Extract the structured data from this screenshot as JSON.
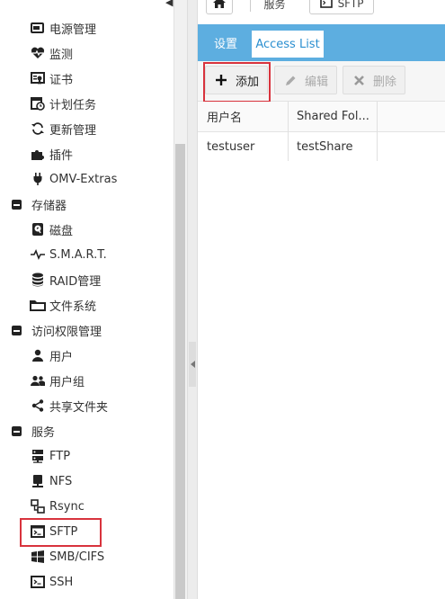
{
  "sidebar": {
    "items": [
      {
        "label": "电源管理",
        "icon": "power-icon"
      },
      {
        "label": "监测",
        "icon": "heart-pulse-icon"
      },
      {
        "label": "证书",
        "icon": "certificate-icon"
      },
      {
        "label": "计划任务",
        "icon": "calendar-clock-icon"
      },
      {
        "label": "更新管理",
        "icon": "refresh-icon"
      },
      {
        "label": "插件",
        "icon": "puzzle-icon"
      },
      {
        "label": "OMV-Extras",
        "icon": "plug-icon"
      },
      {
        "label": "存储器",
        "icon": "collapse-icon"
      },
      {
        "label": "磁盘",
        "icon": "disk-icon"
      },
      {
        "label": "S.M.A.R.T.",
        "icon": "pulse-icon"
      },
      {
        "label": "RAID管理",
        "icon": "database-icon"
      },
      {
        "label": "文件系统",
        "icon": "folder-icon"
      },
      {
        "label": "访问权限管理",
        "icon": "collapse-icon"
      },
      {
        "label": "用户",
        "icon": "user-icon"
      },
      {
        "label": "用户组",
        "icon": "users-icon"
      },
      {
        "label": "共享文件夹",
        "icon": "share-icon"
      },
      {
        "label": "服务",
        "icon": "collapse-icon"
      },
      {
        "label": "FTP",
        "icon": "server-icon"
      },
      {
        "label": "NFS",
        "icon": "nfs-icon"
      },
      {
        "label": "Rsync",
        "icon": "rsync-icon"
      },
      {
        "label": "SFTP",
        "icon": "terminal-icon"
      },
      {
        "label": "SMB/CIFS",
        "icon": "windows-icon"
      },
      {
        "label": "SSH",
        "icon": "terminal-icon"
      }
    ]
  },
  "breadcrumb": {
    "home_icon": "home-icon",
    "item1": "服务",
    "item2": "SFTP",
    "item2_icon": "terminal-icon"
  },
  "tabs": {
    "settings": "设置",
    "access_list": "Access List"
  },
  "toolbar": {
    "add": "添加",
    "edit": "编辑",
    "delete": "删除"
  },
  "grid": {
    "columns": [
      "用户名",
      "Shared Fol..."
    ],
    "rows": [
      [
        "testuser",
        "testShare"
      ]
    ]
  },
  "colors": {
    "tab_bar": "#5daee0",
    "highlight_box": "#d8333d",
    "active_tab_text": "#2a8fd0"
  }
}
